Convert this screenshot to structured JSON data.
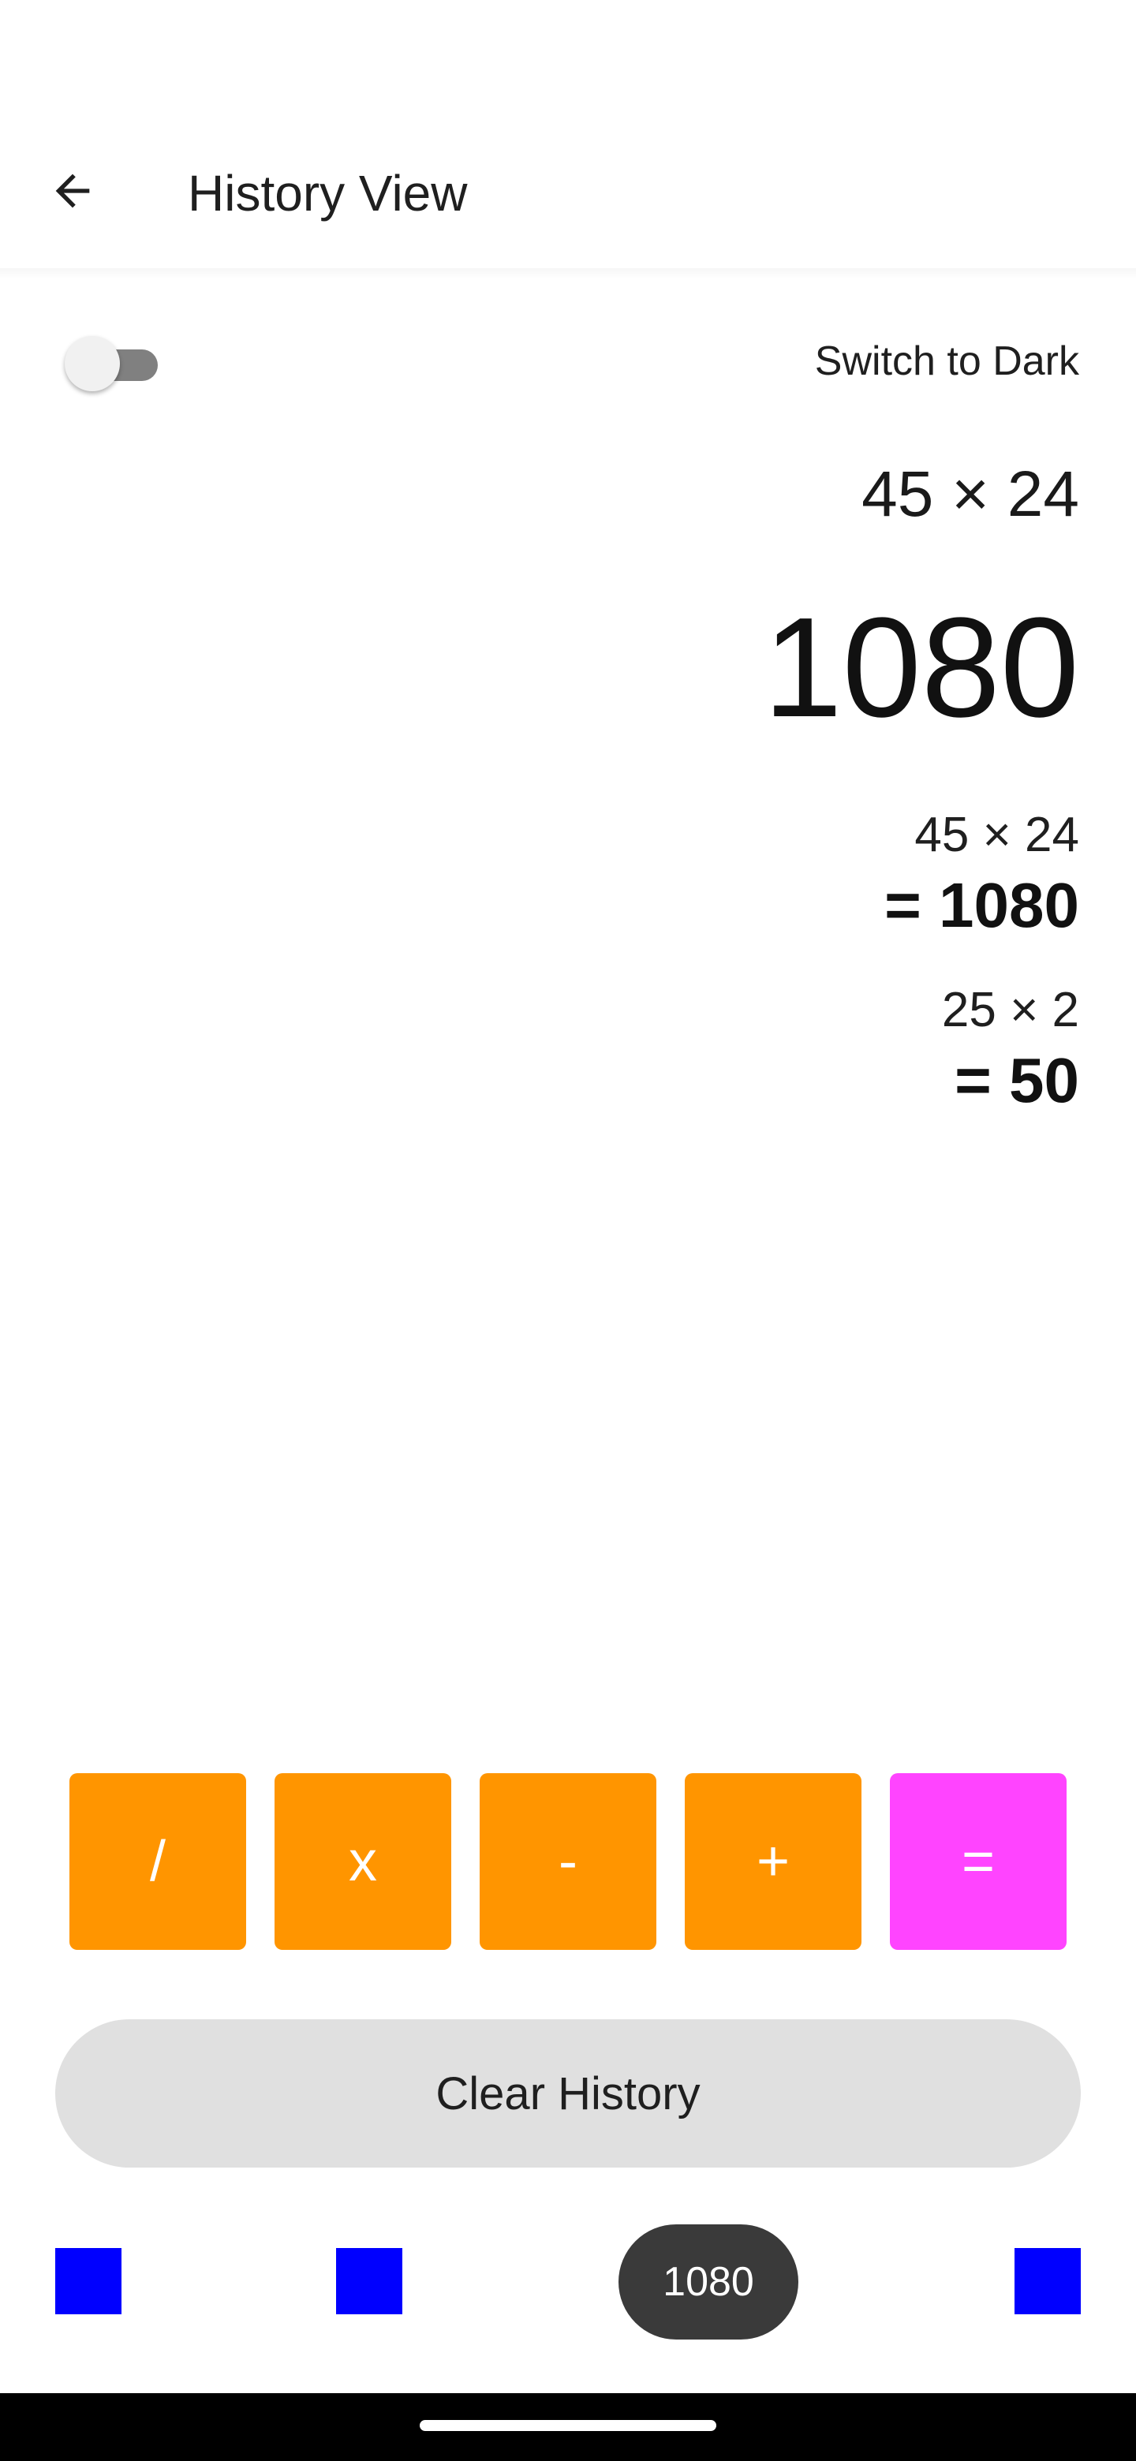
{
  "header": {
    "title": "History View",
    "back_icon": "arrow-back-icon"
  },
  "theme": {
    "switch_on": false,
    "label": "Switch to Dark"
  },
  "display": {
    "expression": "45 × 24",
    "result": "1080"
  },
  "history": [
    {
      "expression": "45 × 24",
      "result": "= 1080"
    },
    {
      "expression": "25 × 2",
      "result": "= 50"
    }
  ],
  "operators": [
    {
      "label": "/",
      "color": "#ff9500"
    },
    {
      "label": "x",
      "color": "#ff9500"
    },
    {
      "label": "-",
      "color": "#ff9500"
    },
    {
      "label": "+",
      "color": "#ff9500"
    },
    {
      "label": "=",
      "color": "#ff44ff"
    }
  ],
  "clear_history_label": "Clear History",
  "bottom_bar": {
    "square_color": "#0000ff",
    "pill_text": "1080"
  }
}
